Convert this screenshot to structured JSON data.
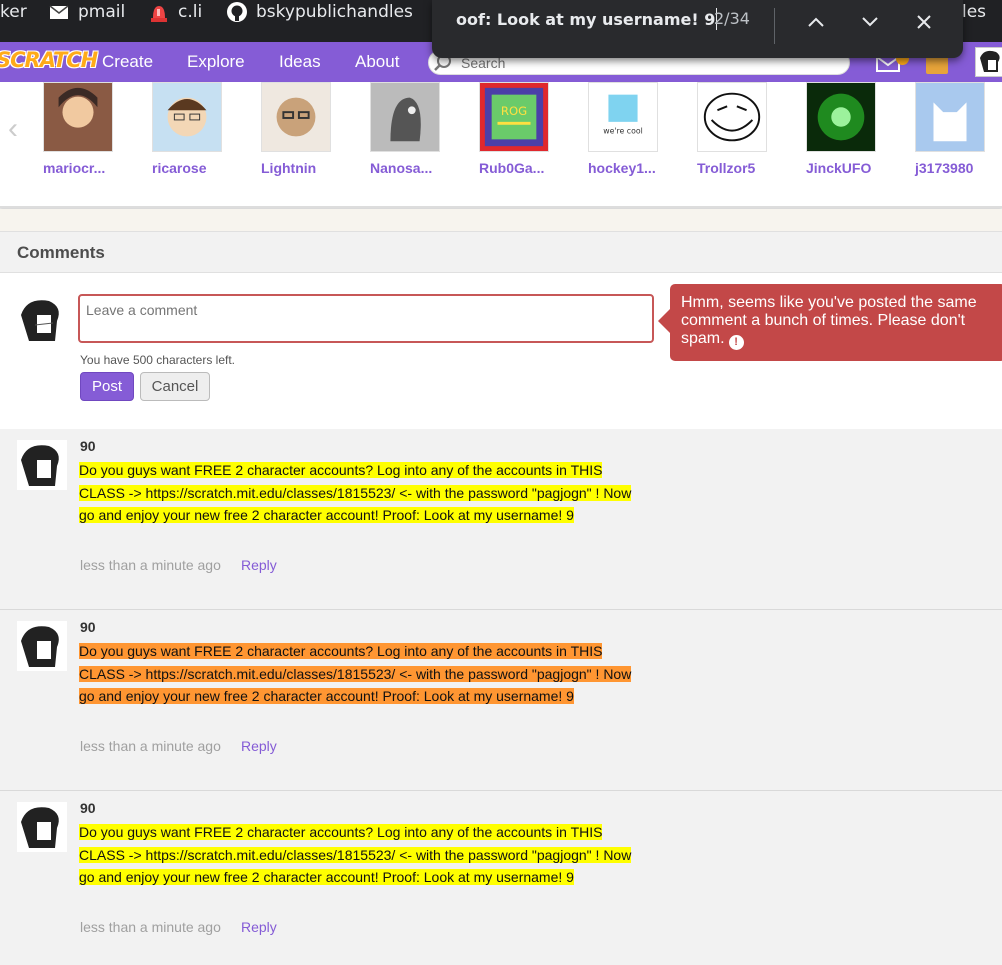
{
  "bookmarks": [
    {
      "label": "ker",
      "icon": "none"
    },
    {
      "label": "pmail",
      "icon": "mail-icon"
    },
    {
      "label": "c.li",
      "icon": "siren-icon"
    },
    {
      "label": "bskypublichandles",
      "icon": "github-icon"
    },
    {
      "label": "les",
      "icon": "none"
    }
  ],
  "find": {
    "query": "oof: Look at my username! 9",
    "count": "2/34"
  },
  "nav": {
    "logo": "SCRATCH",
    "links": [
      "Create",
      "Explore",
      "Ideas",
      "About"
    ],
    "search_placeholder": "Search"
  },
  "curators": [
    {
      "name": "mariocr...",
      "color": "#8a5a44"
    },
    {
      "name": "ricarose",
      "color": "#f3d7b6"
    },
    {
      "name": "Lightnin",
      "color": "#c9a27a"
    },
    {
      "name": "Nanosa...",
      "color": "#555555"
    },
    {
      "name": "Rub0Ga...",
      "color": "#4b3fa8"
    },
    {
      "name": "hockey1...",
      "color": "#7fd3f0"
    },
    {
      "name": "Trollzor5",
      "color": "#ffffff"
    },
    {
      "name": "JinckUFO",
      "color": "#1f8a1f"
    },
    {
      "name": "j3173980",
      "color": "#a9c9ee"
    }
  ],
  "comments": {
    "title": "Comments",
    "compose": {
      "placeholder": "Leave a comment",
      "chars_left": "You have 500 characters left.",
      "post_label": "Post",
      "cancel_label": "Cancel"
    },
    "error": "Hmm, seems like you've posted the same comment a bunch of times. Please don't spam.",
    "items": [
      {
        "user": "90",
        "text": "Do you guys want FREE 2 character accounts? Log into any of the accounts in THIS CLASS -> https://scratch.mit.edu/classes/1815523/ <- with the password \"pagjogn\" ! Now go and enjoy your new free 2 character account! Proof: Look at my username! 9",
        "time": "less than a minute ago",
        "reply": "Reply"
      },
      {
        "user": "90",
        "text": "Do you guys want FREE 2 character accounts? Log into any of the accounts in THIS CLASS -> https://scratch.mit.edu/classes/1815523/ <- with the password \"pagjogn\" ! Now go and enjoy your new free 2 character account! Proof: Look at my username! 9",
        "time": "less than a minute ago",
        "reply": "Reply"
      },
      {
        "user": "90",
        "text": "Do you guys want FREE 2 character accounts? Log into any of the accounts in THIS CLASS -> https://scratch.mit.edu/classes/1815523/ <- with the password \"pagjogn\" ! Now go and enjoy your new free 2 character account! Proof: Look at my username! 9",
        "time": "less than a minute ago",
        "reply": "Reply"
      }
    ]
  },
  "colors": {
    "scratch_purple": "#855cd6",
    "error_red": "#c34848",
    "find_match": "#ffff00",
    "find_current": "#ff9632"
  }
}
